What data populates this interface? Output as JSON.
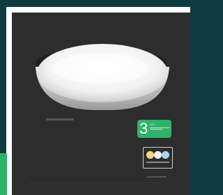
{
  "badge": {
    "number": "3",
    "text": "CCT"
  },
  "colors": {
    "background": "#0e3b3f",
    "frame": "#ffffff",
    "panel": "#2d2d2d",
    "accent": "#2fb36a"
  },
  "icons": [
    "ceiling-light-image",
    "cct-color-temperature-icon"
  ]
}
